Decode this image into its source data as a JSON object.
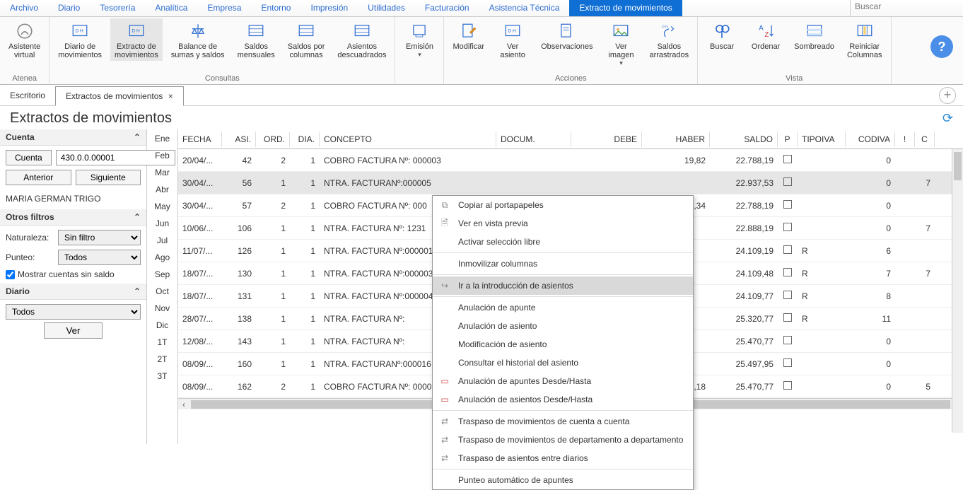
{
  "menubar": {
    "items": [
      "Archivo",
      "Diario",
      "Tesorería",
      "Analítica",
      "Empresa",
      "Entorno",
      "Impresión",
      "Utilidades",
      "Facturación",
      "Asistencia Técnica",
      "Extracto de movimientos"
    ],
    "active_index": 10,
    "search_placeholder": "Buscar"
  },
  "ribbon": {
    "groups": [
      {
        "label": "Atenea",
        "buttons": [
          {
            "label": "Asistente\nvirtual",
            "name": "asistente-virtual-button"
          }
        ]
      },
      {
        "label": "Consultas",
        "buttons": [
          {
            "label": "Diario de\nmovimientos",
            "name": "diario-movimientos-button"
          },
          {
            "label": "Extracto de\nmovimientos",
            "name": "extracto-movimientos-button",
            "active": true
          },
          {
            "label": "Balance de\nsumas y saldos",
            "name": "balance-sumas-saldos-button"
          },
          {
            "label": "Saldos\nmensuales",
            "name": "saldos-mensuales-button"
          },
          {
            "label": "Saldos por\ncolumnas",
            "name": "saldos-columnas-button"
          },
          {
            "label": "Asientos\ndescuadrados",
            "name": "asientos-descuadrados-button"
          }
        ]
      },
      {
        "label": "",
        "buttons": [
          {
            "label": "Emisión",
            "name": "emision-button",
            "dropdown": true
          }
        ]
      },
      {
        "label": "Acciones",
        "buttons": [
          {
            "label": "Modificar",
            "name": "modificar-button"
          },
          {
            "label": "Ver\nasiento",
            "name": "ver-asiento-button"
          },
          {
            "label": "Observaciones",
            "name": "observaciones-button"
          },
          {
            "label": "Ver\nimagen",
            "name": "ver-imagen-button",
            "dropdown": true
          },
          {
            "label": "Saldos\narrastrados",
            "name": "saldos-arrastrados-button"
          }
        ]
      },
      {
        "label": "Vista",
        "buttons": [
          {
            "label": "Buscar",
            "name": "buscar-button"
          },
          {
            "label": "Ordenar",
            "name": "ordenar-button"
          },
          {
            "label": "Sombreado",
            "name": "sombreado-button"
          },
          {
            "label": "Reiniciar\nColumnas",
            "name": "reiniciar-columnas-button"
          }
        ]
      }
    ]
  },
  "doc_tabs": {
    "items": [
      {
        "label": "Escritorio",
        "closable": false
      },
      {
        "label": "Extractos de movimientos",
        "closable": true,
        "active": true
      }
    ]
  },
  "page_title": "Extractos de movimientos",
  "left_panel": {
    "cuenta_header": "Cuenta",
    "cuenta_btn": "Cuenta",
    "cuenta_value": "430.0.0.00001",
    "anterior_btn": "Anterior",
    "siguiente_btn": "Siguiente",
    "account_name": "MARIA GERMAN TRIGO",
    "otros_filtros_header": "Otros filtros",
    "naturaleza_label": "Naturaleza:",
    "naturaleza_value": "Sin filtro",
    "punteo_label": "Punteo:",
    "punteo_value": "Todos",
    "mostrar_sin_saldo_label": "Mostrar cuentas sin saldo",
    "mostrar_sin_saldo_checked": true,
    "diario_header": "Diario",
    "diario_value": "Todos",
    "ver_btn": "Ver"
  },
  "months": [
    "Ene",
    "Feb",
    "Mar",
    "Abr",
    "May",
    "Jun",
    "Jul",
    "Ago",
    "Sep",
    "Oct",
    "Nov",
    "Dic",
    "1T",
    "2T",
    "3T"
  ],
  "grid": {
    "columns": [
      "FECHA",
      "ASI.",
      "ORD.",
      "DIA.",
      "CONCEPTO",
      "DOCUM.",
      "DEBE",
      "HABER",
      "SALDO",
      "P",
      "TIPOIVA",
      "CODIVA",
      "!",
      "C"
    ],
    "selected_row": 1,
    "rows": [
      {
        "fecha": "20/04/...",
        "asi": "42",
        "ord": "2",
        "dia": "1",
        "concepto": "COBRO FACTURA Nº: 000003",
        "docum": "",
        "debe": "",
        "haber": "19,82",
        "saldo": "22.788,19",
        "p": false,
        "tipoiva": "",
        "codiva": "0",
        "ex": "",
        "c": ""
      },
      {
        "fecha": "30/04/...",
        "asi": "56",
        "ord": "1",
        "dia": "1",
        "concepto": "NTRA. FACTURANº:000005",
        "docum": "",
        "debe": "",
        "haber": "",
        "saldo": "22.937,53",
        "p": false,
        "tipoiva": "",
        "codiva": "0",
        "ex": "",
        "c": "7"
      },
      {
        "fecha": "30/04/...",
        "asi": "57",
        "ord": "2",
        "dia": "1",
        "concepto": "COBRO FACTURA Nº: 000",
        "docum": "",
        "debe": "",
        "haber": "149,34",
        "saldo": "22.788,19",
        "p": false,
        "tipoiva": "",
        "codiva": "0",
        "ex": "",
        "c": ""
      },
      {
        "fecha": "10/06/...",
        "asi": "106",
        "ord": "1",
        "dia": "1",
        "concepto": "NTRA. FACTURA Nº:  1231",
        "docum": "",
        "debe": "",
        "haber": "",
        "saldo": "22.888,19",
        "p": false,
        "tipoiva": "",
        "codiva": "0",
        "ex": "",
        "c": "7"
      },
      {
        "fecha": "11/07/...",
        "asi": "126",
        "ord": "1",
        "dia": "1",
        "concepto": "NTRA. FACTURA Nº:000001",
        "docum": "",
        "debe": "",
        "haber": "",
        "saldo": "24.109,19",
        "p": false,
        "tipoiva": "R",
        "codiva": "6",
        "ex": "",
        "c": ""
      },
      {
        "fecha": "18/07/...",
        "asi": "130",
        "ord": "1",
        "dia": "1",
        "concepto": "NTRA. FACTURA Nº:000003",
        "docum": "",
        "debe": "",
        "haber": "",
        "saldo": "24.109,48",
        "p": false,
        "tipoiva": "R",
        "codiva": "7",
        "ex": "",
        "c": "7"
      },
      {
        "fecha": "18/07/...",
        "asi": "131",
        "ord": "1",
        "dia": "1",
        "concepto": "NTRA. FACTURA Nº:000004",
        "docum": "",
        "debe": "",
        "haber": "",
        "saldo": "24.109,77",
        "p": false,
        "tipoiva": "R",
        "codiva": "8",
        "ex": "",
        "c": ""
      },
      {
        "fecha": "28/07/...",
        "asi": "138",
        "ord": "1",
        "dia": "1",
        "concepto": "NTRA. FACTURA Nº:",
        "docum": "",
        "debe": "",
        "haber": "",
        "saldo": "25.320,77",
        "p": false,
        "tipoiva": "R",
        "codiva": "11",
        "ex": "",
        "c": ""
      },
      {
        "fecha": "12/08/...",
        "asi": "143",
        "ord": "1",
        "dia": "1",
        "concepto": "NTRA. FACTURA Nº:",
        "docum": "",
        "debe": "",
        "haber": "",
        "saldo": "25.470,77",
        "p": false,
        "tipoiva": "",
        "codiva": "0",
        "ex": "",
        "c": ""
      },
      {
        "fecha": "08/09/...",
        "asi": "160",
        "ord": "1",
        "dia": "1",
        "concepto": "NTRA. FACTURANº:000016",
        "docum": "",
        "debe": "",
        "haber": "",
        "saldo": "25.497,95",
        "p": false,
        "tipoiva": "",
        "codiva": "0",
        "ex": "",
        "c": ""
      },
      {
        "fecha": "08/09/...",
        "asi": "162",
        "ord": "2",
        "dia": "1",
        "concepto": "COBRO FACTURA Nº: 000016",
        "docum": "",
        "debe": "",
        "haber": "27,18",
        "saldo": "25.470,77",
        "p": false,
        "tipoiva": "",
        "codiva": "0",
        "ex": "",
        "c": "5"
      }
    ]
  },
  "context_menu": {
    "items": [
      {
        "label": "Copiar al portapapeles",
        "icon": "copy-icon"
      },
      {
        "label": "Ver en vista previa",
        "icon": "preview-icon"
      },
      {
        "label": "Activar selección libre",
        "icon": ""
      },
      {
        "sep": true
      },
      {
        "label": "Inmovilizar columnas",
        "icon": ""
      },
      {
        "sep": true
      },
      {
        "label": "Ir a la introducción de asientos",
        "icon": "goto-icon",
        "hover": true
      },
      {
        "sep": true
      },
      {
        "label": "Anulación de apunte",
        "icon": ""
      },
      {
        "label": "Anulación de asiento",
        "icon": ""
      },
      {
        "label": "Modificación de asiento",
        "icon": ""
      },
      {
        "label": "Consultar el historial del asiento",
        "icon": ""
      },
      {
        "label": "Anulación de apuntes Desde/Hasta",
        "icon": "range-icon"
      },
      {
        "label": "Anulación de asientos Desde/Hasta",
        "icon": "range-icon"
      },
      {
        "sep": true
      },
      {
        "label": "Traspaso de movimientos de cuenta a cuenta",
        "icon": "transfer-icon"
      },
      {
        "label": "Traspaso de movimientos de departamento a departamento",
        "icon": "transfer-icon"
      },
      {
        "label": "Traspaso de asientos entre diarios",
        "icon": "transfer-icon"
      },
      {
        "sep": true
      },
      {
        "label": "Punteo automático de apuntes",
        "icon": ""
      }
    ]
  }
}
